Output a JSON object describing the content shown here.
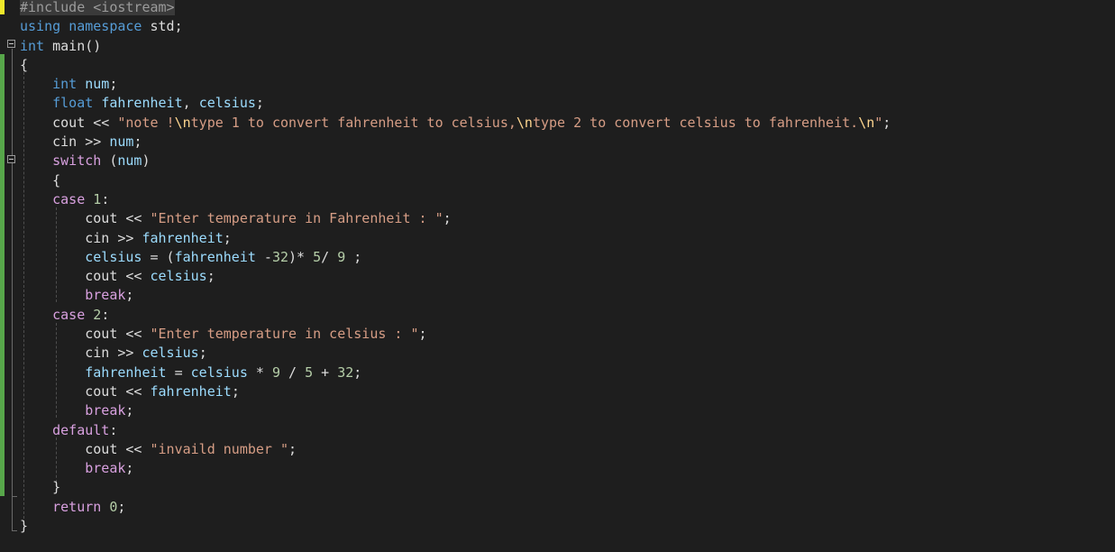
{
  "editor": {
    "language": "cpp",
    "lines": [
      [
        {
          "t": "#include <iostream>",
          "c": "pp"
        }
      ],
      [
        {
          "t": "using",
          "c": "kw"
        },
        {
          "t": " ",
          "c": "plain"
        },
        {
          "t": "namespace",
          "c": "kw"
        },
        {
          "t": " std;",
          "c": "plain"
        }
      ],
      [
        {
          "t": "int",
          "c": "kw"
        },
        {
          "t": " main()",
          "c": "plain"
        }
      ],
      [
        {
          "t": "{",
          "c": "plain"
        }
      ],
      [
        {
          "t": "    ",
          "c": "plain"
        },
        {
          "t": "int",
          "c": "kw"
        },
        {
          "t": " ",
          "c": "plain"
        },
        {
          "t": "num",
          "c": "id"
        },
        {
          "t": ";",
          "c": "plain"
        }
      ],
      [
        {
          "t": "    ",
          "c": "plain"
        },
        {
          "t": "float",
          "c": "kw"
        },
        {
          "t": " ",
          "c": "plain"
        },
        {
          "t": "fahrenheit",
          "c": "id"
        },
        {
          "t": ", ",
          "c": "plain"
        },
        {
          "t": "celsius",
          "c": "id"
        },
        {
          "t": ";",
          "c": "plain"
        }
      ],
      [
        {
          "t": "    cout << ",
          "c": "plain"
        },
        {
          "t": "\"note !",
          "c": "str"
        },
        {
          "t": "\\n",
          "c": "esc"
        },
        {
          "t": "type 1 to convert fahrenheit to celsius,",
          "c": "str"
        },
        {
          "t": "\\n",
          "c": "esc"
        },
        {
          "t": "type 2 to convert celsius to fahrenheit.",
          "c": "str"
        },
        {
          "t": "\\n",
          "c": "esc"
        },
        {
          "t": "\"",
          "c": "str"
        },
        {
          "t": ";",
          "c": "plain"
        }
      ],
      [
        {
          "t": "    cin >> ",
          "c": "plain"
        },
        {
          "t": "num",
          "c": "id"
        },
        {
          "t": ";",
          "c": "plain"
        }
      ],
      [
        {
          "t": "    ",
          "c": "plain"
        },
        {
          "t": "switch",
          "c": "ctl"
        },
        {
          "t": " (",
          "c": "plain"
        },
        {
          "t": "num",
          "c": "id"
        },
        {
          "t": ")",
          "c": "plain"
        }
      ],
      [
        {
          "t": "    {",
          "c": "plain"
        }
      ],
      [
        {
          "t": "    ",
          "c": "plain"
        },
        {
          "t": "case",
          "c": "ctl"
        },
        {
          "t": " ",
          "c": "plain"
        },
        {
          "t": "1",
          "c": "num"
        },
        {
          "t": ":",
          "c": "plain"
        }
      ],
      [
        {
          "t": "        cout << ",
          "c": "plain"
        },
        {
          "t": "\"Enter temperature in Fahrenheit : \"",
          "c": "str"
        },
        {
          "t": ";",
          "c": "plain"
        }
      ],
      [
        {
          "t": "        cin >> ",
          "c": "plain"
        },
        {
          "t": "fahrenheit",
          "c": "id"
        },
        {
          "t": ";",
          "c": "plain"
        }
      ],
      [
        {
          "t": "        ",
          "c": "plain"
        },
        {
          "t": "celsius",
          "c": "id"
        },
        {
          "t": " = (",
          "c": "plain"
        },
        {
          "t": "fahrenheit",
          "c": "id"
        },
        {
          "t": " -",
          "c": "plain"
        },
        {
          "t": "32",
          "c": "num"
        },
        {
          "t": ")* ",
          "c": "plain"
        },
        {
          "t": "5",
          "c": "num"
        },
        {
          "t": "/ ",
          "c": "plain"
        },
        {
          "t": "9",
          "c": "num"
        },
        {
          "t": " ;",
          "c": "plain"
        }
      ],
      [
        {
          "t": "        cout << ",
          "c": "plain"
        },
        {
          "t": "celsius",
          "c": "id"
        },
        {
          "t": ";",
          "c": "plain"
        }
      ],
      [
        {
          "t": "        ",
          "c": "plain"
        },
        {
          "t": "break",
          "c": "ctl"
        },
        {
          "t": ";",
          "c": "plain"
        }
      ],
      [
        {
          "t": "    ",
          "c": "plain"
        },
        {
          "t": "case",
          "c": "ctl"
        },
        {
          "t": " ",
          "c": "plain"
        },
        {
          "t": "2",
          "c": "num"
        },
        {
          "t": ":",
          "c": "plain"
        }
      ],
      [
        {
          "t": "        cout << ",
          "c": "plain"
        },
        {
          "t": "\"Enter temperature in celsius : \"",
          "c": "str"
        },
        {
          "t": ";",
          "c": "plain"
        }
      ],
      [
        {
          "t": "        cin >> ",
          "c": "plain"
        },
        {
          "t": "celsius",
          "c": "id"
        },
        {
          "t": ";",
          "c": "plain"
        }
      ],
      [
        {
          "t": "        ",
          "c": "plain"
        },
        {
          "t": "fahrenheit",
          "c": "id"
        },
        {
          "t": " = ",
          "c": "plain"
        },
        {
          "t": "celsius",
          "c": "id"
        },
        {
          "t": " * ",
          "c": "plain"
        },
        {
          "t": "9",
          "c": "num"
        },
        {
          "t": " / ",
          "c": "plain"
        },
        {
          "t": "5",
          "c": "num"
        },
        {
          "t": " + ",
          "c": "plain"
        },
        {
          "t": "32",
          "c": "num"
        },
        {
          "t": ";",
          "c": "plain"
        }
      ],
      [
        {
          "t": "        cout << ",
          "c": "plain"
        },
        {
          "t": "fahrenheit",
          "c": "id"
        },
        {
          "t": ";",
          "c": "plain"
        }
      ],
      [
        {
          "t": "        ",
          "c": "plain"
        },
        {
          "t": "break",
          "c": "ctl"
        },
        {
          "t": ";",
          "c": "plain"
        }
      ],
      [
        {
          "t": "    ",
          "c": "plain"
        },
        {
          "t": "default",
          "c": "ctl"
        },
        {
          "t": ":",
          "c": "plain"
        }
      ],
      [
        {
          "t": "        cout << ",
          "c": "plain"
        },
        {
          "t": "\"invaild number \"",
          "c": "str"
        },
        {
          "t": ";",
          "c": "plain"
        }
      ],
      [
        {
          "t": "        ",
          "c": "plain"
        },
        {
          "t": "break",
          "c": "ctl"
        },
        {
          "t": ";",
          "c": "plain"
        }
      ],
      [
        {
          "t": "    }",
          "c": "plain"
        }
      ],
      [
        {
          "t": "    ",
          "c": "plain"
        },
        {
          "t": "return",
          "c": "ctl"
        },
        {
          "t": " ",
          "c": "plain"
        },
        {
          "t": "0",
          "c": "num"
        },
        {
          "t": ";",
          "c": "plain"
        }
      ],
      [
        {
          "t": "}",
          "c": "plain"
        }
      ]
    ]
  },
  "colors": {
    "background": "#1e1e1e",
    "keyword": "#569cd6",
    "control": "#d8a0df",
    "string": "#d69d85",
    "identifier": "#9cdcfe",
    "number": "#b5cea8",
    "changed_marker_saved": "#57a64a",
    "changed_marker_unsaved": "#efe82a"
  },
  "icons": {
    "fold_main": "collapse-minus-icon",
    "fold_switch": "collapse-minus-icon"
  }
}
